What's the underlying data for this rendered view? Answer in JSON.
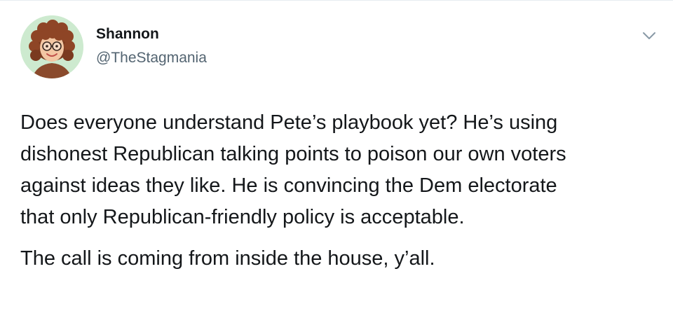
{
  "tweet": {
    "author": {
      "display_name": "Shannon",
      "handle": "@TheStagmania",
      "avatar_icon": "memoji-avatar",
      "avatar_bg": "#cdeacf"
    },
    "menu_icon": "chevron-down-icon",
    "paragraphs": [
      "Does everyone understand Pete’s playbook yet? He’s using\ndishonest Republican talking points to poison our own voters\nagainst ideas they like. He is convincing the Dem electorate\nthat only Republican-friendly policy is acceptable.",
      "The call is coming from inside the house, y’all."
    ]
  },
  "colors": {
    "text": "#14171a",
    "secondary_text": "#536471",
    "border": "#e6ecf0"
  }
}
